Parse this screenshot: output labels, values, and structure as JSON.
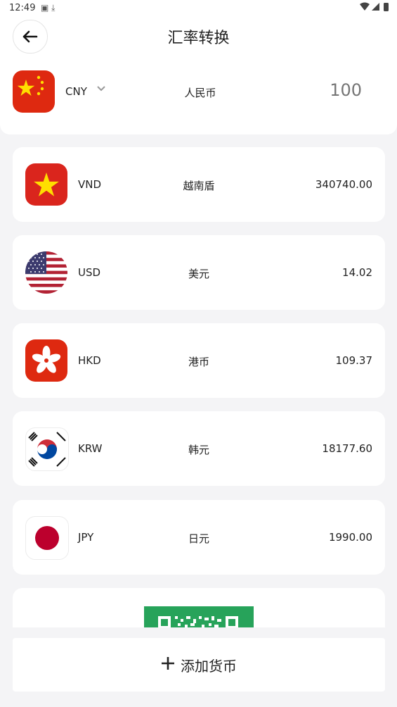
{
  "status": {
    "time": "12:49"
  },
  "header": {
    "title": "汇率转换",
    "base": {
      "code": "CNY",
      "name": "人民币",
      "amount_placeholder": "100"
    }
  },
  "currencies": [
    {
      "code": "VND",
      "name": "越南盾",
      "value": "340740.00"
    },
    {
      "code": "USD",
      "name": "美元",
      "value": "14.02"
    },
    {
      "code": "HKD",
      "name": "港币",
      "value": "109.37"
    },
    {
      "code": "KRW",
      "name": "韩元",
      "value": "18177.60"
    },
    {
      "code": "JPY",
      "name": "日元",
      "value": "1990.00"
    }
  ],
  "add_button": {
    "label": "添加货币"
  },
  "colors": {
    "background": "#f4f4f6",
    "china_red": "#de2910",
    "vietnam_red": "#da251d",
    "star_yellow": "#ffde00",
    "ad_green": "#27a35a"
  },
  "icons": {
    "back": "arrow-left-icon",
    "dropdown": "chevron-down-icon",
    "add": "plus-icon"
  }
}
